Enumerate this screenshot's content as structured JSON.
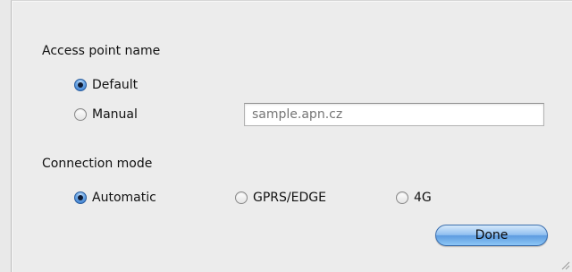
{
  "access_point": {
    "heading": "Access point name",
    "options": [
      {
        "label": "Default",
        "selected": true
      },
      {
        "label": "Manual",
        "selected": false
      }
    ],
    "apn_field": {
      "placeholder": "sample.apn.cz",
      "value": ""
    }
  },
  "connection_mode": {
    "heading": "Connection mode",
    "options": [
      {
        "label": "Automatic",
        "selected": true
      },
      {
        "label": "GPRS/EDGE",
        "selected": false
      },
      {
        "label": "4G",
        "selected": false
      }
    ]
  },
  "buttons": {
    "done_label": "Done"
  },
  "colors": {
    "accent": "#5d9be0",
    "background": "#ececec"
  }
}
